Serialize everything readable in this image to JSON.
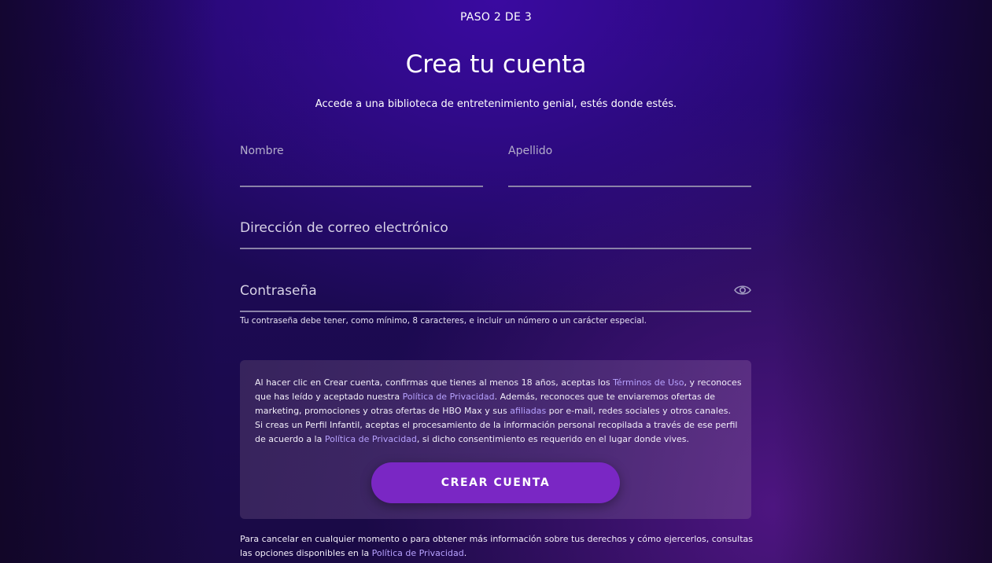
{
  "header": {
    "step": "PASO 2 DE 3",
    "title": "Crea tu cuenta",
    "subtitle": "Accede a una biblioteca de entretenimiento genial, estés donde estés."
  },
  "form": {
    "first_name_placeholder": "Nombre",
    "last_name_placeholder": "Apellido",
    "email_placeholder": "Dirección de correo electrónico",
    "password_placeholder": "Contraseña",
    "password_hint": "Tu contraseña debe tener, como mínimo, 8 caracteres, e incluir un número o un carácter especial."
  },
  "consent": {
    "line1_pre": "Al hacer clic en Crear cuenta, confirmas que tienes al menos 18 años, aceptas los ",
    "line1_link": "Términos de Uso",
    "line1_post": ", y reconoces",
    "line2_pre": "que has leído y aceptado nuestra ",
    "line2_link": "Política de Privacidad",
    "line2_post": ". Además, reconoces que te enviaremos ofertas de",
    "line3_pre": "marketing, promociones y otras ofertas de HBO Max y sus ",
    "line3_link": "afiliadas",
    "line3_post": " por e-mail, redes sociales y otros canales.",
    "line4": "Si creas un Perfil Infantil, aceptas el procesamiento de la información personal recopilada a través de ese perfil",
    "line5_pre": "de acuerdo a la ",
    "line5_link": "Política de Privacidad",
    "line5_post": ", si dicho consentimiento es requerido en el lugar donde vives.",
    "button_label": "CREAR CUENTA"
  },
  "footer": {
    "line1": "Para cancelar en cualquier momento o para obtener más información sobre tus derechos y cómo ejercerlos, consultas",
    "line2_pre": "las opciones disponibles en la ",
    "line2_link": "Política de Privacidad",
    "line2_post": "."
  },
  "icons": {
    "password_toggle": "eye-icon"
  },
  "colors": {
    "accent": "#7a27c4",
    "link": "#b7a2ff",
    "background": "#22086a"
  }
}
